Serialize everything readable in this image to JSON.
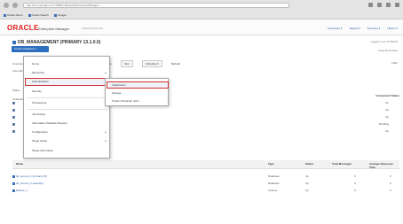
{
  "browser": {
    "url": "http://em.example.com:7788/em/faces/sdk/nonFacesWrapper",
    "bookmarks": [
      "Oracle Demo",
      "Oracle Search",
      "Google"
    ]
  },
  "header": {
    "logo": "ORACLE",
    "product": "Enterprise Manager",
    "product_sub": "Cloud Control 13c",
    "links": [
      "Enterprise ▾",
      "Targets ▾",
      "Favorites ▾",
      "History ▾"
    ]
  },
  "context": {
    "title": "DB_MANAGEMENT (PRIMARY 13.1.0.0)",
    "target_type_button": "Oracle Database ▾",
    "right_top": "Logged in as SYSMAN",
    "right_bottom": "Page Refreshed"
  },
  "toolbar": {
    "items": [
      "Mode:",
      "Run",
      "Schedule ▾",
      "Refresh"
    ],
    "right": "Filter"
  },
  "left_labels": [
    "Overview",
    "Summary",
    "Status",
    "Incidents"
  ],
  "menu": {
    "items": [
      {
        "label": "Home",
        "arrow": false,
        "highlighted": false
      },
      {
        "label": "Monitoring",
        "arrow": true,
        "highlighted": false
      },
      {
        "label": "Administration",
        "arrow": true,
        "highlighted": true
      },
      {
        "label": "Security",
        "arrow": true,
        "highlighted": false
      },
      {
        "label": "Provisioning",
        "arrow": true,
        "highlighted": false
      },
      {
        "label": "Job Activity",
        "arrow": false,
        "highlighted": false
      },
      {
        "label": "Information Publisher Reports",
        "arrow": false,
        "highlighted": false
      },
      {
        "label": "Configuration",
        "arrow": true,
        "highlighted": false
      },
      {
        "label": "Target Setup",
        "arrow": true,
        "highlighted": false
      },
      {
        "label": "Target Information",
        "arrow": false,
        "highlighted": false
      }
    ]
  },
  "submenu": {
    "items": [
      {
        "label": "Initialization",
        "highlighted": true
      },
      {
        "label": "Storage",
        "highlighted": false
      },
      {
        "label": "Oracle Scheduler Jobs",
        "highlighted": false
      }
    ]
  },
  "upper_table": {
    "header": "Component Status",
    "rows": [
      "Up",
      "Up",
      "Up",
      "Pending",
      "Up"
    ]
  },
  "lower_table": {
    "columns": [
      "Name",
      "Type",
      "Status",
      "Total Messages",
      "Average Response Time"
    ],
    "rows": [
      {
        "name": "db_service_1 (primary) (0)",
        "type": "Database",
        "status": "Up",
        "total": "0",
        "avg": "0"
      },
      {
        "name": "db_service_2 (standby)",
        "type": "Database",
        "status": "Up",
        "total": "0",
        "avg": "0"
      },
      {
        "name": "listener_1",
        "type": "Listener",
        "status": "Up",
        "total": "0",
        "avg": "0"
      }
    ]
  }
}
